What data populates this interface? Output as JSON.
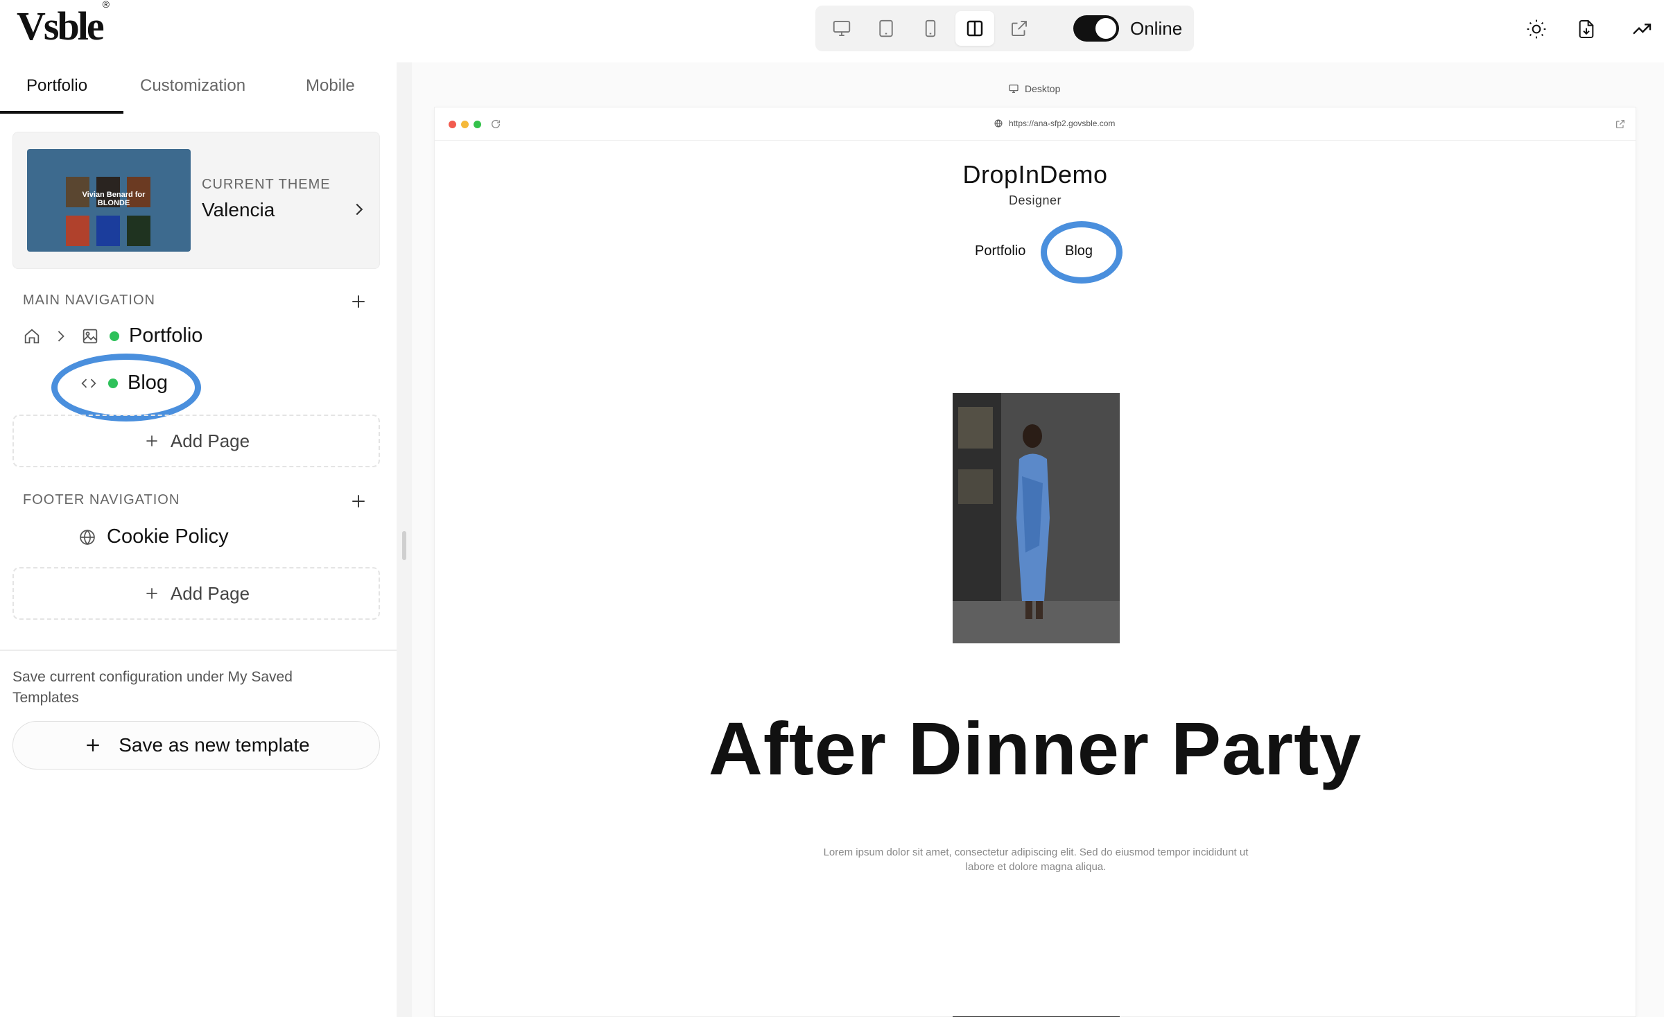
{
  "app": {
    "logo": "Vsble",
    "logo_mark": "®"
  },
  "devicebar": {
    "icons": [
      "desktop-icon",
      "tablet-icon",
      "mobile-icon",
      "split-view-icon",
      "external-link-icon"
    ],
    "status_label": "Online",
    "online": true
  },
  "top_right_icons": [
    "sun-icon",
    "download-icon",
    "analytics-icon"
  ],
  "sidebar": {
    "tabs": [
      "Portfolio",
      "Customization",
      "Mobile"
    ],
    "active_tab": "Portfolio",
    "theme": {
      "label": "CURRENT THEME",
      "name": "Valencia",
      "thumbnail_text": "Vivian Benard for BLONDE"
    },
    "main_nav": {
      "label": "MAIN NAVIGATION",
      "items": [
        {
          "label": "Portfolio",
          "icon": "image-icon",
          "status": "published"
        },
        {
          "label": "Blog",
          "icon": "code-icon",
          "status": "published"
        }
      ],
      "add_label": "Add Page"
    },
    "footer_nav": {
      "label": "FOOTER NAVIGATION",
      "items": [
        {
          "label": "Cookie Policy",
          "icon": "globe-icon"
        }
      ],
      "add_label": "Add Page"
    },
    "save": {
      "description": "Save current configuration under My Saved Templates",
      "button_label": "Save as new template"
    }
  },
  "preview": {
    "device_label": "Desktop",
    "url": "https://ana-sfp2.govsble.com",
    "site": {
      "name": "DropInDemo",
      "subtitle": "Designer",
      "nav": [
        "Portfolio",
        "Blog"
      ],
      "headline": "After Dinner Party",
      "body": "Lorem ipsum dolor sit amet, consectetur adipiscing elit. Sed do eiusmod tempor incididunt ut labore et dolore magna aliqua."
    }
  },
  "colors": {
    "accent_ring": "#4a8fdd",
    "status_green": "#2ec15a",
    "toggle_dark": "#111111"
  }
}
